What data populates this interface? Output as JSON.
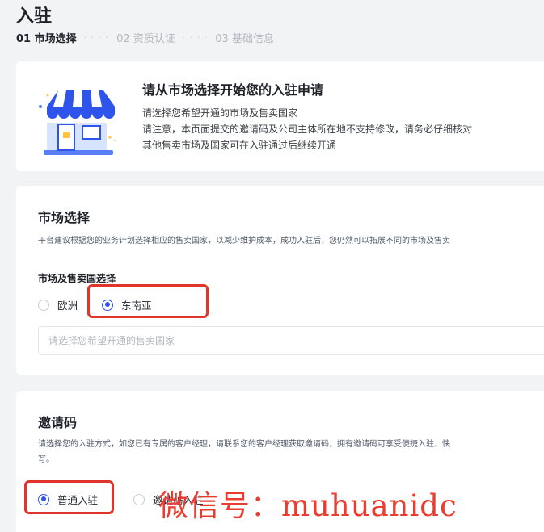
{
  "header": {
    "title": "入驻",
    "steps": [
      {
        "label": "01 市场选择",
        "active": true
      },
      {
        "label": "02 资质认证",
        "active": false
      },
      {
        "label": "03 基础信息",
        "active": false
      }
    ],
    "step_separator": "· · · ·"
  },
  "intro": {
    "illustration_icon": "shop-storefront-icon",
    "title": "请从市场选择开始您的入驻申请",
    "lines": [
      "请选择您希望开通的市场及售卖国家",
      "请注意，本页面提交的邀请码及公司主体所在地不支持修改，请务必仔细核对",
      "其他售卖市场及国家可在入驻通过后继续开通"
    ]
  },
  "market": {
    "title": "市场选择",
    "description": "平台建议根据您的业务计划选择相应的售卖国家，以减少维护成本，成功入驻后，您仍然可以拓展不同的市场及售卖",
    "field_label": "市场及售卖国选择",
    "options": [
      {
        "label": "欧洲",
        "checked": false
      },
      {
        "label": "东南亚",
        "checked": true
      }
    ],
    "country_select": {
      "placeholder": "请选择您希望开通的售卖国家"
    }
  },
  "invite": {
    "title": "邀请码",
    "description_lines": [
      "请选择您的入驻方式，如您已有专属的客户经理，请联系您的客户经理获取邀请码，拥有邀请码可享受便捷入驻，快",
      "写。"
    ],
    "options": [
      {
        "label": "普通入驻",
        "checked": true
      },
      {
        "label": "邀请码入驻",
        "checked": false
      }
    ]
  },
  "watermark": "微信号：muhuanidc",
  "colors": {
    "primary": "#2f54eb",
    "highlight_border": "#e0352b",
    "watermark": "#ec3b2f",
    "background": "#f2f3f5"
  }
}
